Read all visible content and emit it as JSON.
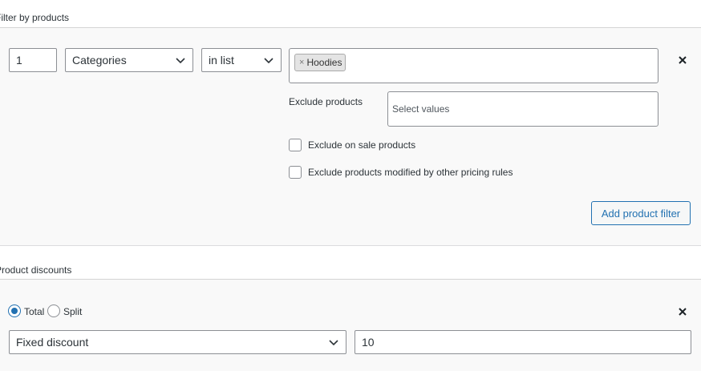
{
  "filter_section": {
    "title": "Filter by products",
    "row": {
      "quantity": "1",
      "type_select": "Categories",
      "method_select": "in list",
      "selected_tags": [
        "Hoodies"
      ],
      "tag_remove_symbol": "×"
    },
    "exclude_products_label": "Exclude products",
    "exclude_products_placeholder": "Select values",
    "exclude_on_sale_label": "Exclude on sale products",
    "exclude_on_sale_checked": false,
    "exclude_modified_label": "Exclude products modified by other pricing rules",
    "exclude_modified_checked": false,
    "add_filter_button": "Add product filter"
  },
  "discount_section": {
    "title": "Product discounts",
    "mode_options": [
      "Total",
      "Split"
    ],
    "mode_selected": "Total",
    "discount_type": "Fixed discount",
    "discount_value": "10"
  },
  "colors": {
    "accent": "#2271b1",
    "border": "#8c8f94"
  },
  "icons": {
    "remove_row": "close-icon",
    "dropdown": "chevron-down-icon"
  }
}
